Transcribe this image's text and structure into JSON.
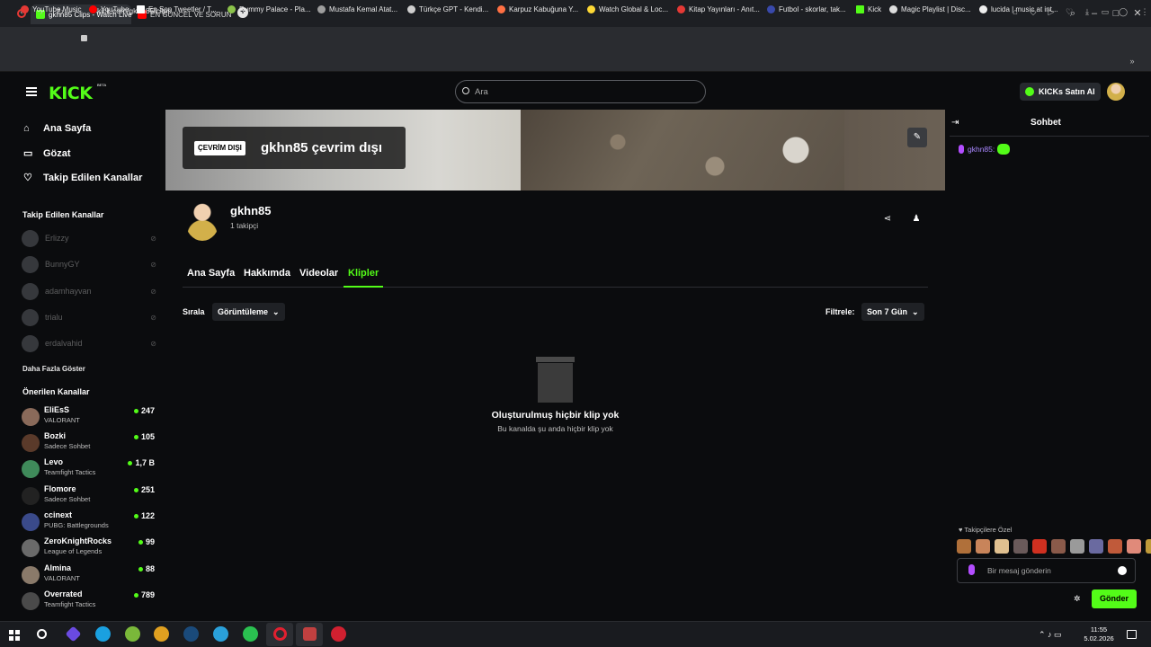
{
  "browser": {
    "tabs": [
      {
        "title": "gkhn85 Clips - Watch Live",
        "active": true
      },
      {
        "title": "EN GÜNCEL VE SORUNSU",
        "active": false
      }
    ],
    "new_tab": "+",
    "url": "kick.com/gkhn85/clips"
  },
  "bookmarks": [
    {
      "label": "YouTube Music",
      "color": "#e53935"
    },
    {
      "label": "YouTube",
      "color": "#ff0000"
    },
    {
      "label": "En Son Tweetler / T...",
      "color": "#ffffff"
    },
    {
      "label": "Rummy Palace - Pla...",
      "color": "#8bc34a"
    },
    {
      "label": "Mustafa Kemal Atat...",
      "color": "#9e9e9e"
    },
    {
      "label": "Türkçe GPT - Kendi...",
      "color": "#cfcfcf"
    },
    {
      "label": "Karpuz Kabuğuna Y...",
      "color": "#ff7043"
    },
    {
      "label": "Watch Global & Loc...",
      "color": "#fdd835"
    },
    {
      "label": "Kitap Yayınları - Anıt...",
      "color": "#e53935"
    },
    {
      "label": "Futbol - skorlar, tak...",
      "color": "#3949ab"
    },
    {
      "label": "Kick",
      "color": "#53fc18"
    },
    {
      "label": "Magic Playlist | Disc...",
      "color": "#dddddd"
    },
    {
      "label": "lucida | music at int...",
      "color": "#eeeeee"
    }
  ],
  "header": {
    "logo": "KICK",
    "logo_tag": "BETA",
    "search_placeholder": "Ara",
    "kicks_button": "KICKs Satın Al"
  },
  "sidebar": {
    "nav": [
      {
        "label": "Ana Sayfa",
        "icon": "home-icon"
      },
      {
        "label": "Gözat",
        "icon": "browse-icon"
      },
      {
        "label": "Takip Edilen Kanallar",
        "icon": "heart-icon"
      }
    ],
    "followed_heading": "Takip Edilen Kanallar",
    "followed": [
      {
        "name": "Erlizzy"
      },
      {
        "name": "BunnyGY"
      },
      {
        "name": "adamhayvan"
      },
      {
        "name": "trialu"
      },
      {
        "name": "erdalvahid"
      }
    ],
    "show_more": "Daha Fazla Göster",
    "recommended_heading": "Önerilen Kanallar",
    "recommended": [
      {
        "name": "EliEsS",
        "category": "VALORANT",
        "viewers": "247"
      },
      {
        "name": "Bozki",
        "category": "Sadece Sohbet",
        "viewers": "105"
      },
      {
        "name": "Levo",
        "category": "Teamfight Tactics",
        "viewers": "1,7 B"
      },
      {
        "name": "Flomore",
        "category": "Sadece Sohbet",
        "viewers": "251"
      },
      {
        "name": "ccinext",
        "category": "PUBG: Battlegrounds",
        "viewers": "122"
      },
      {
        "name": "ZeroKnightRocks",
        "category": "League of Legends",
        "viewers": "99"
      },
      {
        "name": "Almina",
        "category": "VALORANT",
        "viewers": "88"
      },
      {
        "name": "Overrated",
        "category": "Teamfight Tactics",
        "viewers": "789"
      }
    ]
  },
  "banner": {
    "offline_badge": "ÇEVRİM DIŞI",
    "offline_title": "gkhn85 çevrim dışı"
  },
  "channel": {
    "name": "gkhn85",
    "followers": "1 takipçi",
    "tabs": [
      {
        "label": "Ana Sayfa",
        "active": false
      },
      {
        "label": "Hakkımda",
        "active": false
      },
      {
        "label": "Videolar",
        "active": false
      },
      {
        "label": "Klipler",
        "active": true
      }
    ],
    "sort_label": "Sırala",
    "sort_value": "Görüntüleme",
    "filter_label": "Filtrele:",
    "filter_value": "Son 7 Gün",
    "empty_title": "Oluşturulmuş hiçbir klip yok",
    "empty_subtitle": "Bu kanalda şu anda hiçbir klip yok"
  },
  "chat": {
    "title": "Sohbet",
    "message_user": "gkhn85:",
    "subscribers_label": "Takipçilere Özel",
    "input_placeholder": "Bir mesaj gönderin",
    "send_label": "Gönder"
  },
  "taskbar": {
    "time": "11:55",
    "date": "5.02.2026"
  },
  "colors": {
    "accent": "#53fc18",
    "background": "#0b0c0e"
  }
}
